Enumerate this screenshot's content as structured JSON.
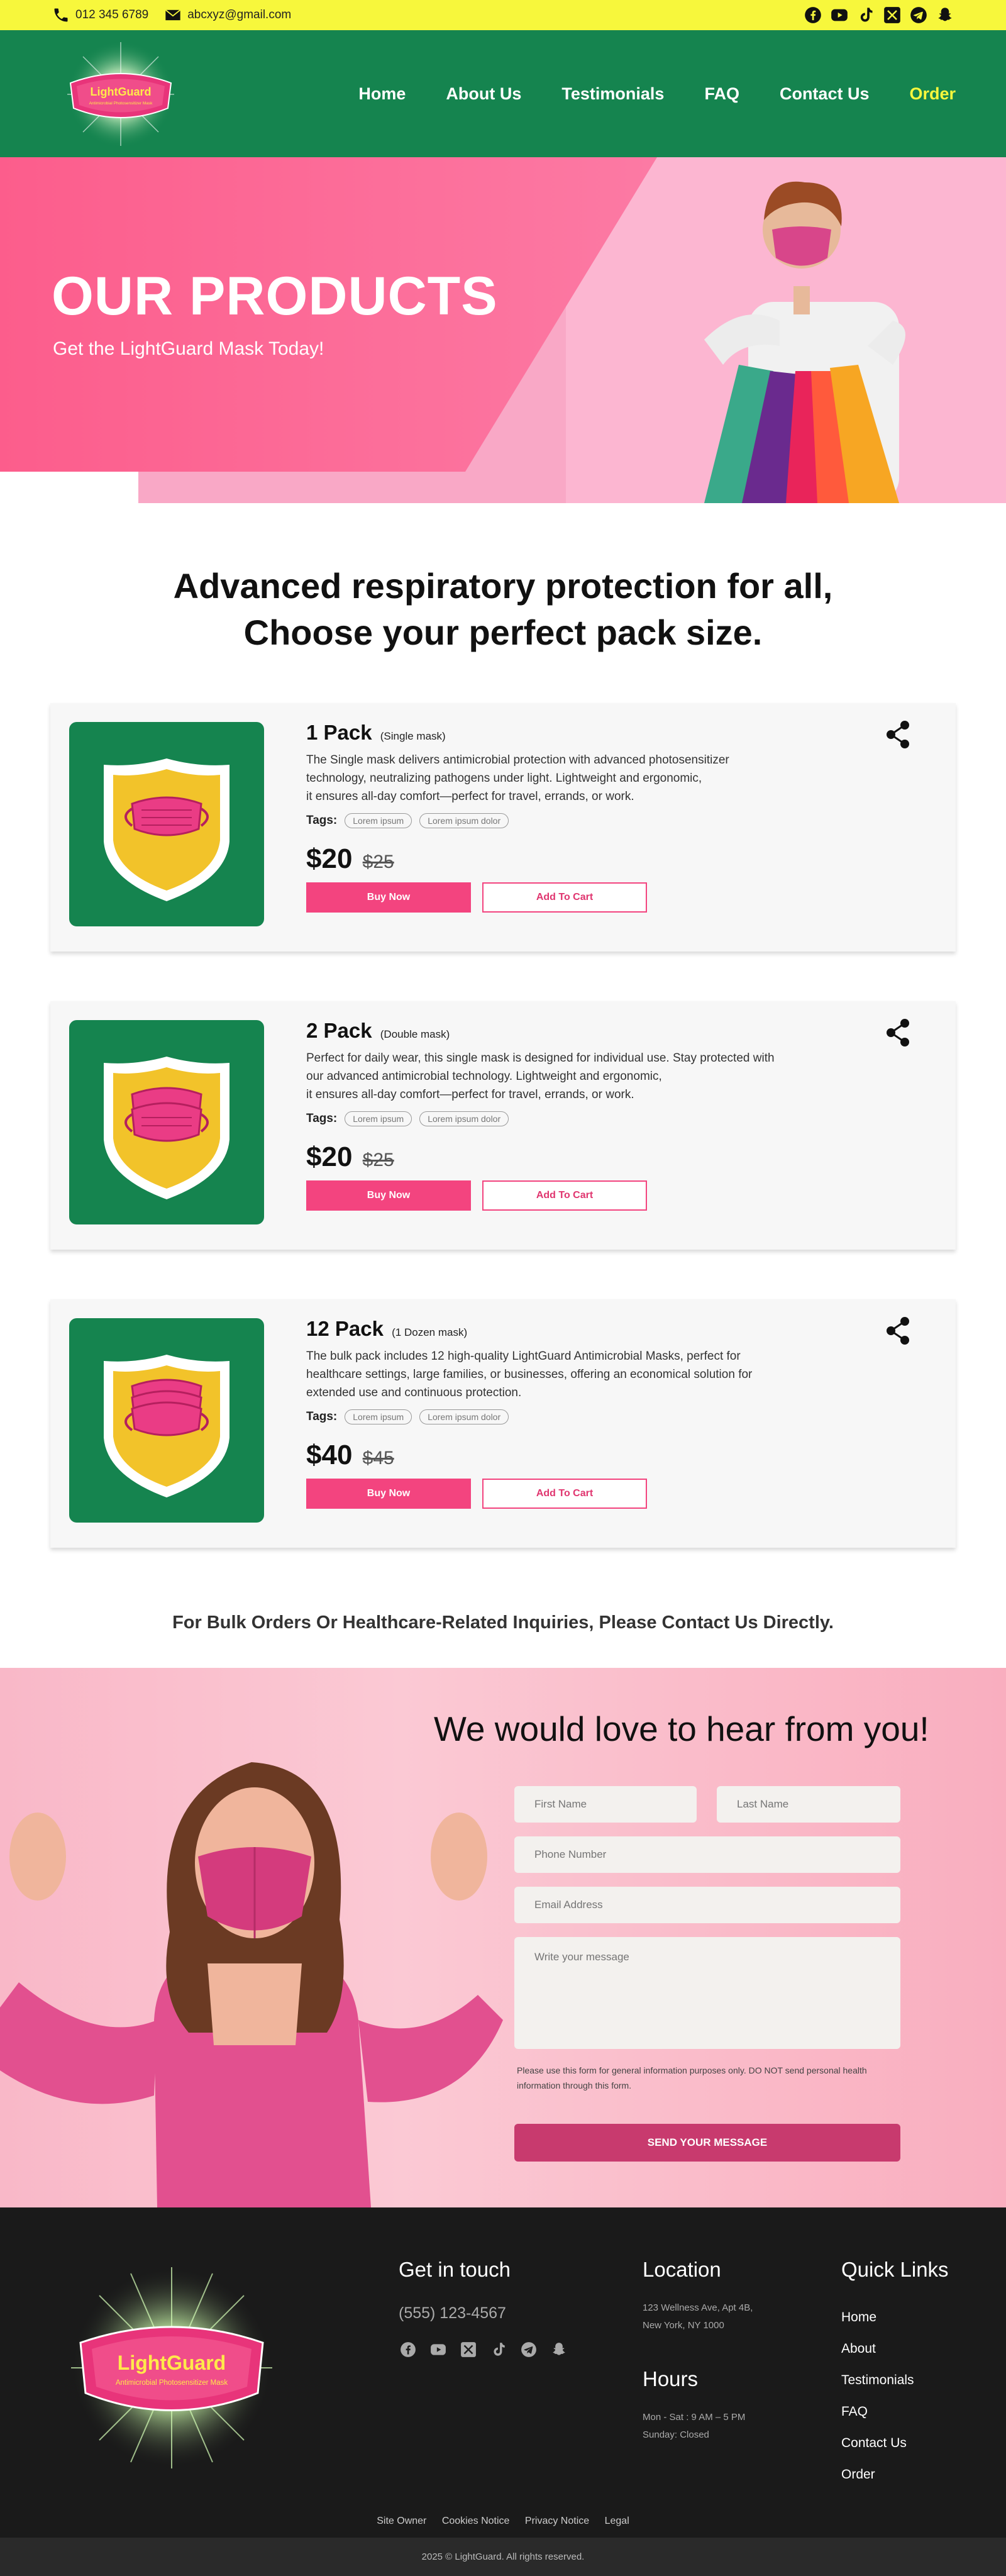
{
  "topbar": {
    "phone": "012 345 6789",
    "email": "abcxyz@gmail.com",
    "social_icons": [
      "facebook-icon",
      "youtube-icon",
      "tiktok-icon",
      "x-icon",
      "telegram-icon",
      "snapchat-icon"
    ]
  },
  "brand": {
    "logo_text": "LightGuard",
    "logo_subtext": "Antimicrobial Photosensitizer Mask"
  },
  "nav": {
    "items": [
      "Home",
      "About Us",
      "Testimonials",
      "FAQ",
      "Contact Us",
      "Order"
    ]
  },
  "hero": {
    "title": "OUR PRODUCTS",
    "subtitle": "Get the LightGuard Mask Today!"
  },
  "headline": {
    "line1": "Advanced respiratory protection for all,",
    "line2": "Choose your perfect pack size."
  },
  "products": [
    {
      "name": "1 Pack",
      "qualifier": "(Single mask)",
      "desc1": "The Single mask delivers antimicrobial protection with advanced photosensitizer",
      "desc2": "technology, neutralizing pathogens under light. Lightweight and ergonomic,",
      "desc3": "it ensures all-day comfort—perfect for travel, errands, or work.",
      "desc4": "",
      "tags_label": "Tags:",
      "tags": [
        "Lorem ipsum",
        "Lorem ipsum dolor"
      ],
      "price": "$20",
      "old_price": "$25",
      "buy_label": "Buy Now",
      "cart_label": "Add To Cart"
    },
    {
      "name": "2 Pack",
      "qualifier": "(Double mask)",
      "desc1": "Perfect for daily wear, this single mask is designed for individual use. Stay protected with",
      "desc2": "our advanced antimicrobial technology. Lightweight and ergonomic,",
      "desc3": "it ensures all-day comfort—perfect for travel, errands, or work.",
      "desc4": "",
      "tags_label": "Tags:",
      "tags": [
        "Lorem ipsum",
        "Lorem ipsum dolor"
      ],
      "price": "$20",
      "old_price": "$25",
      "buy_label": "Buy Now",
      "cart_label": "Add To Cart"
    },
    {
      "name": "12 Pack",
      "qualifier": "(1 Dozen mask)",
      "desc1": "The  bulk pack includes 12 high-quality LightGuard Antimicrobial Masks, perfect for",
      "desc2": "healthcare settings, large families, or businesses, offering an economical solution for",
      "desc3": "extended use and continuous protection.",
      "desc4": "",
      "tags_label": "Tags:",
      "tags": [
        "Lorem ipsum",
        "Lorem ipsum dolor"
      ],
      "price": "$40",
      "old_price": "$45",
      "buy_label": "Buy Now",
      "cart_label": "Add To Cart"
    }
  ],
  "bulk_notice": "For Bulk Orders Or Healthcare-Related Inquiries, Please Contact Us Directly.",
  "contact_form": {
    "title": "We would love to hear from you!",
    "first_name": "First Name",
    "last_name": "Last Name",
    "phone": "Phone Number",
    "email": "Email Address",
    "message": "Write your message",
    "notice": "Please use this form for general information purposes only. DO NOT send personal health information through this form.",
    "submit": "SEND YOUR MESSAGE"
  },
  "footer": {
    "touch_title": "Get in touch",
    "phone": "(555) 123-4567",
    "location_title": "Location",
    "address1": "123 Wellness Ave, Apt 4B,",
    "address2": "New York, NY 1000",
    "hours_title": "Hours",
    "hours1": "Mon - Sat : 9 AM – 5 PM",
    "hours2": "Sunday: Closed",
    "links_title": "Quick Links",
    "links": [
      "Home",
      "About",
      "Testimonials",
      "FAQ",
      "Contact Us",
      "Order"
    ],
    "bottom_links": [
      "Site Owner",
      "Cookies Notice",
      "Privacy Notice",
      "Legal"
    ],
    "copyright": "2025 © LightGuard.  All rights reserved."
  },
  "colors": {
    "topbar": "#f7f73c",
    "nav": "#15844f",
    "pink": "#f3447f",
    "footer": "#1a1a1a"
  }
}
